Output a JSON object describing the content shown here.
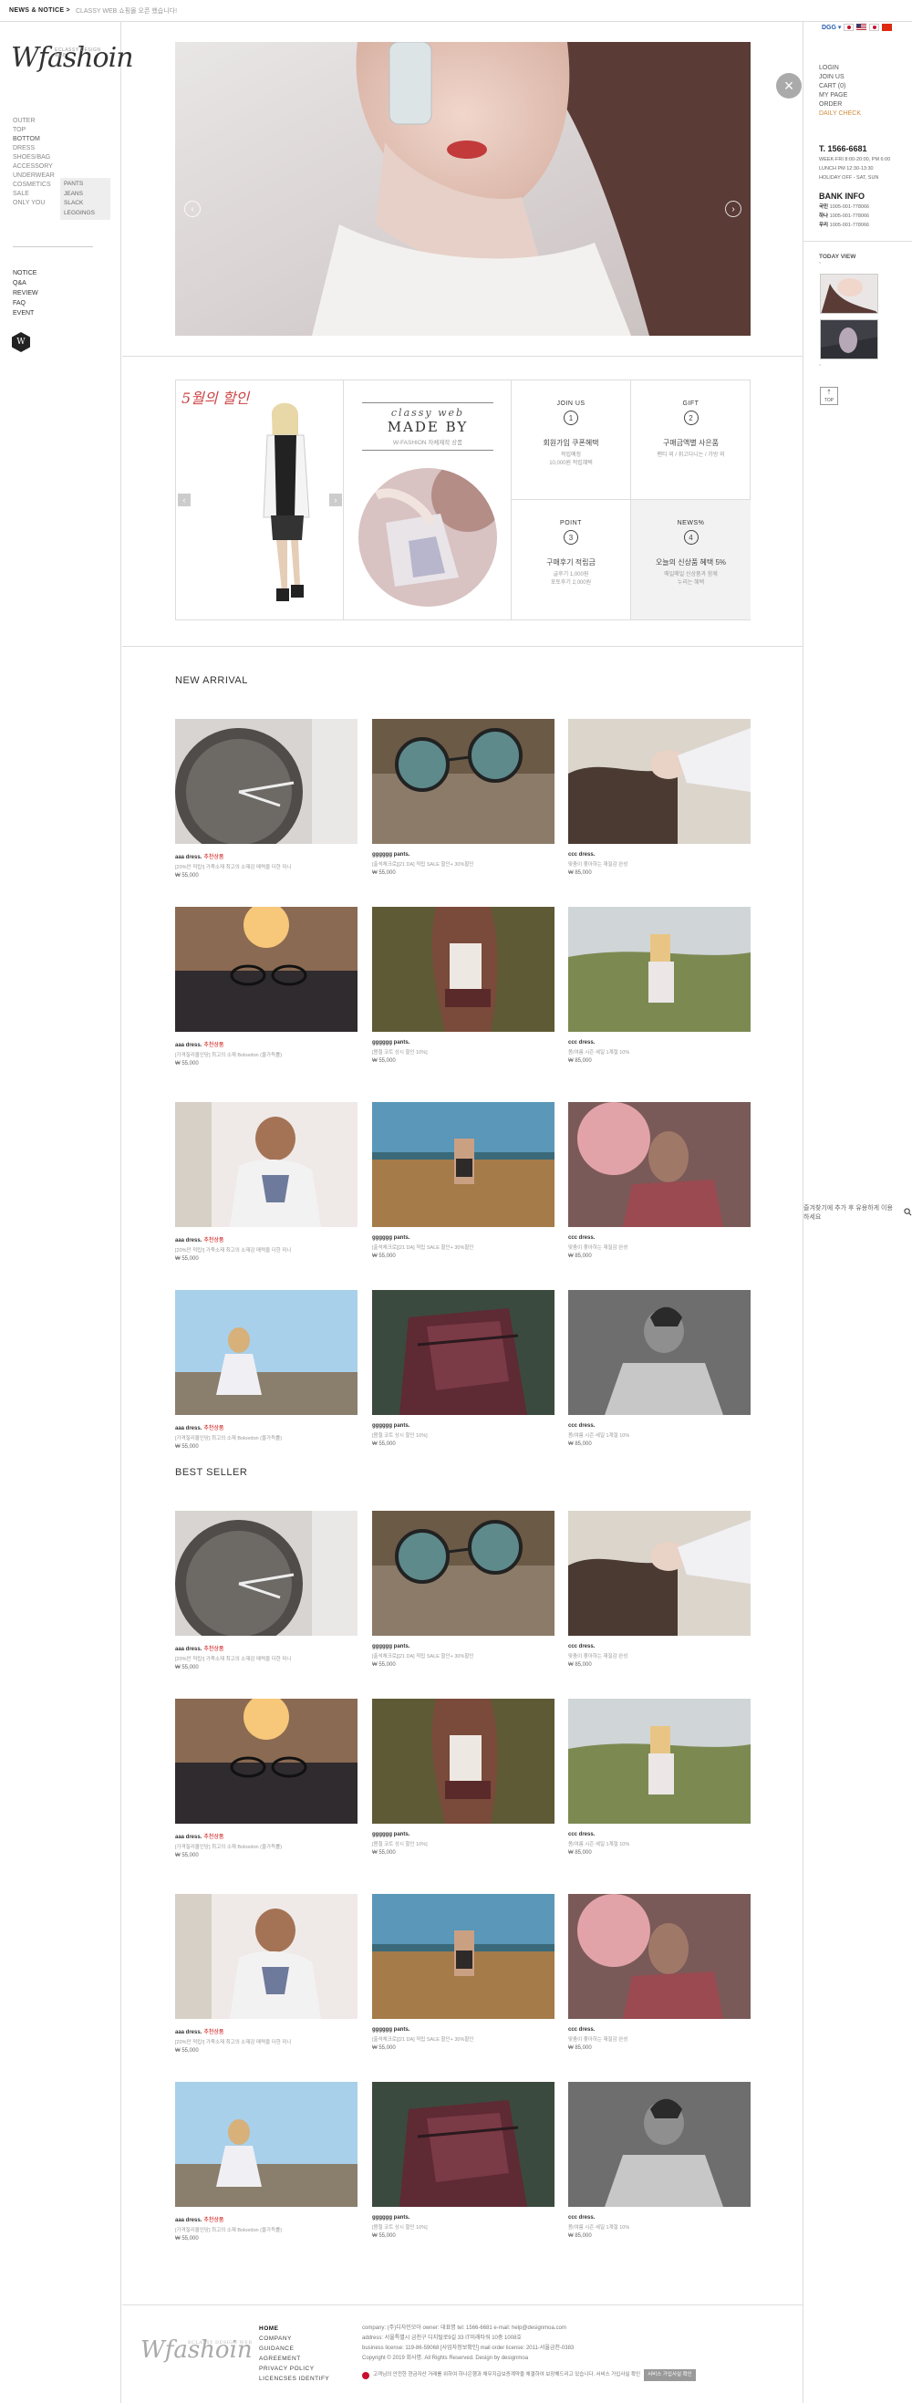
{
  "topbar": {
    "news_label": "NEWS & NOTICE >",
    "ticker": "CLASSY WEB 쇼핑몰 오픈 했습니다!",
    "bookmark": "즐겨찾기에 추가 후 유용하게 이용하세요"
  },
  "brand": {
    "logo": "Wfashoin",
    "logo_sub": "ECLASSY DESIGN WEB"
  },
  "categories": [
    "OUTER",
    "TOP",
    "BOTTOM",
    "DRESS",
    "SHOES/BAG",
    "ACCESSORY",
    "UNDERWEAR",
    "COSMETICS",
    "SALE",
    "ONLY YOU"
  ],
  "sub_categories": [
    "PANTS",
    "JEANS",
    "SLACK",
    "LEGGINGS"
  ],
  "board_menu": [
    "NOTICE",
    "Q&A",
    "REVIEW",
    "FAQ",
    "EVENT"
  ],
  "badge": "W",
  "colors": {
    "accent": "#c8102e",
    "sale": "#cc0000",
    "bg": "#ffffff",
    "border": "#dddddd"
  },
  "promo": {
    "banner_text": "5월의 할인",
    "made_script": "classy web",
    "made_title": "MADE BY",
    "made_sub": "W-FASHION 자체제작 상품",
    "boxes": [
      {
        "title": "JOIN US",
        "num": "1",
        "desc": "회원가입 쿠폰혜택",
        "sub": "적립예정\n10,000원 적립혜택"
      },
      {
        "title": "GIFT",
        "num": "2",
        "desc": "구매금액별 사은품",
        "sub": "팬티 외 / 쥐고다니는 / 가방 외"
      },
      {
        "title": "POINT",
        "num": "3",
        "desc": "구매후기 적립금",
        "sub": "글후기 1,000원\n포토후기 2,000원"
      },
      {
        "title": "NEWS%",
        "num": "4",
        "desc": "오늘의 신상품 혜택 5%",
        "sub": "매일매일 신상품과 함께\n누리는 혜택"
      }
    ]
  },
  "sections": {
    "new_arrival": "NEW ARRIVAL",
    "best_seller": "BEST SELLER"
  },
  "products": [
    {
      "name": "aaa dress.",
      "tag": "추천상품",
      "desc": "[20%만 적립!] 가죽소재 최고의 소재감 매력을 더한 미니",
      "price": "₩ 55,000"
    },
    {
      "name": "gggggg pants.",
      "tag": "",
      "desc": "[출석체크로][21 DA] 적립 SALE 할인+ 30%할인",
      "price": "₩ 55,000"
    },
    {
      "name": "ccc dress.",
      "tag": "",
      "desc": "맞춤이 좋아하는 재질감 완성",
      "price": "₩ 85,000"
    },
    {
      "name": "aaa dress.",
      "tag": "추천상품",
      "desc": "[가격질리올인당] 최고의 소재 Boloedon (울가득률)",
      "price": "₩ 55,000"
    },
    {
      "name": "gggggg pants.",
      "tag": "",
      "desc": "[봄철 코트 상시 할인 10%]",
      "price": "₩ 55,000"
    },
    {
      "name": "ccc dress.",
      "tag": "",
      "desc": "봄/여름 시즌 세일 1계절 10%",
      "price": "₩ 85,000"
    },
    {
      "name": "aaa dress.",
      "tag": "추천상품",
      "desc": "[20%만 적립!] 가죽소재 최고의 소재감 매력을 더한 미니",
      "price": "₩ 55,000"
    },
    {
      "name": "gggggg pants.",
      "tag": "",
      "desc": "[출석체크로][21 DA] 적립 SALE 할인+ 30%할인",
      "price": "₩ 55,000"
    },
    {
      "name": "ccc dress.",
      "tag": "",
      "desc": "맞춤이 좋아하는 재질감 완성",
      "price": "₩ 85,000"
    },
    {
      "name": "aaa dress.",
      "tag": "추천상품",
      "desc": "[가격질리올인당] 최고의 소재 Boloedon (울가득률)",
      "price": "₩ 55,000"
    },
    {
      "name": "gggggg pants.",
      "tag": "",
      "desc": "[봄철 코트 상시 할인 10%]",
      "price": "₩ 55,000"
    },
    {
      "name": "ccc dress.",
      "tag": "",
      "desc": "봄/여름 시즌 세일 1계절 10%",
      "price": "₩ 85,000"
    }
  ],
  "footer": {
    "menu": [
      "HOME",
      "COMPANY",
      "GUIDANCE",
      "AGREEMENT",
      "PRIVACY POLICY",
      "LICENCSES IDENTIFY"
    ],
    "info": [
      "company: (주)디자인모아   owner: 대표명   tel: 1566-6681   e-mail: help@designmoa.com",
      "address: 서울특별시 금천구 디지털로9길 33 IT미래타워 10층 1008호",
      "business license: 119-86-59068 [사업자정보확인]   mail order license: 2011-서울금천-0383",
      "Copyright © 2019 회사명. All Rights Reserved. Design by designmoa"
    ],
    "escrow": "고객님의 안전한 현금자산 거래를 위하여 하나은행과 채무지급보증계약을 체결하여 보장해드리고 있습니다. 서비스 가입사실 확인",
    "escrow_button": "서비스 가입사실 확인"
  },
  "sidebar": {
    "links": [
      "LOGIN",
      "JOIN US",
      "CART (0)",
      "MY PAGE",
      "ORDER",
      "DAILY CHECK"
    ],
    "cs_phone": "T. 1566-6681",
    "cs_hours": [
      "WEEK-FRI 8:00-20:00, PM 6:00",
      "LUNCH PM 12:30-13:30",
      "HOLIDAY OFF - SAT, SUN"
    ],
    "bank_title": "BANK INFO",
    "bank": [
      {
        "bank": "국민",
        "num": "1005-001-778066"
      },
      {
        "bank": "하나",
        "num": "1005-001-778066"
      },
      {
        "bank": "우리",
        "num": "1005-001-778066"
      }
    ],
    "today_view": "TODAY VIEW",
    "top_button": "TOP"
  }
}
